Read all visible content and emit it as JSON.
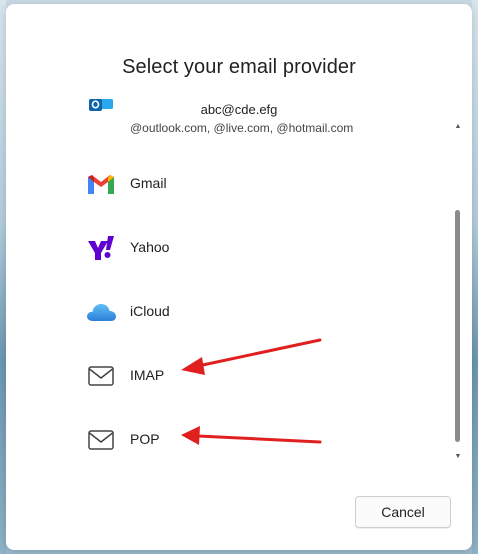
{
  "dialog": {
    "title": "Select your email provider",
    "account": {
      "email": "abc@cde.efg",
      "domains": "@outlook.com, @live.com, @hotmail.com"
    },
    "providers": [
      {
        "label": "Gmail",
        "icon": "gmail-icon"
      },
      {
        "label": "Yahoo",
        "icon": "yahoo-icon"
      },
      {
        "label": "iCloud",
        "icon": "icloud-icon"
      },
      {
        "label": "IMAP",
        "icon": "envelope-icon"
      },
      {
        "label": "POP",
        "icon": "envelope-icon"
      }
    ],
    "cancel_label": "Cancel"
  },
  "annotations": {
    "arrow_color": "#e0201f",
    "arrow_targets": [
      "IMAP",
      "POP"
    ]
  },
  "colors": {
    "dialog_bg": "#ffffff",
    "text": "#1f1f1f",
    "yahoo_purple": "#6001d2",
    "icloud_blue": "#3b9bea"
  }
}
